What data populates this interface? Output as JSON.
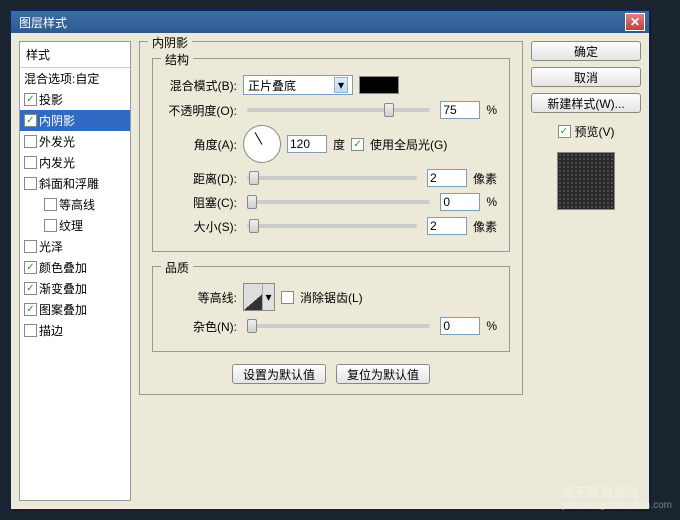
{
  "window": {
    "title": "图层样式"
  },
  "sidebar": {
    "header": "样式",
    "blend_options": "混合选项:自定",
    "items": [
      {
        "label": "投影",
        "checked": true
      },
      {
        "label": "内阴影",
        "checked": true,
        "selected": true
      },
      {
        "label": "外发光",
        "checked": false
      },
      {
        "label": "内发光",
        "checked": false
      },
      {
        "label": "斜面和浮雕",
        "checked": false
      },
      {
        "label": "等高线",
        "checked": false,
        "indent": true
      },
      {
        "label": "纹理",
        "checked": false,
        "indent": true
      },
      {
        "label": "光泽",
        "checked": false
      },
      {
        "label": "颜色叠加",
        "checked": true
      },
      {
        "label": "渐变叠加",
        "checked": true
      },
      {
        "label": "图案叠加",
        "checked": true
      },
      {
        "label": "描边",
        "checked": false
      }
    ]
  },
  "panel": {
    "title": "内阴影",
    "structure": {
      "legend": "结构",
      "blend_mode_label": "混合模式(B):",
      "blend_mode_value": "正片叠底",
      "opacity_label": "不透明度(O):",
      "opacity_value": "75",
      "opacity_unit": "%",
      "angle_label": "角度(A):",
      "angle_value": "120",
      "angle_unit": "度",
      "global_light_label": "使用全局光(G)",
      "global_light_checked": true,
      "distance_label": "距离(D):",
      "distance_value": "2",
      "distance_unit": "像素",
      "choke_label": "阻塞(C):",
      "choke_value": "0",
      "choke_unit": "%",
      "size_label": "大小(S):",
      "size_value": "2",
      "size_unit": "像素"
    },
    "quality": {
      "legend": "品质",
      "contour_label": "等高线:",
      "antialias_label": "消除锯齿(L)",
      "antialias_checked": false,
      "noise_label": "杂色(N):",
      "noise_value": "0",
      "noise_unit": "%"
    },
    "buttons": {
      "make_default": "设置为默认值",
      "reset_default": "复位为默认值"
    }
  },
  "actions": {
    "ok": "确定",
    "cancel": "取消",
    "new_style": "新建样式(W)...",
    "preview_label": "预览(V)",
    "preview_checked": true
  },
  "watermark": {
    "text": "查字典 教程网",
    "url": "jiaocheng.chazidian.com"
  }
}
